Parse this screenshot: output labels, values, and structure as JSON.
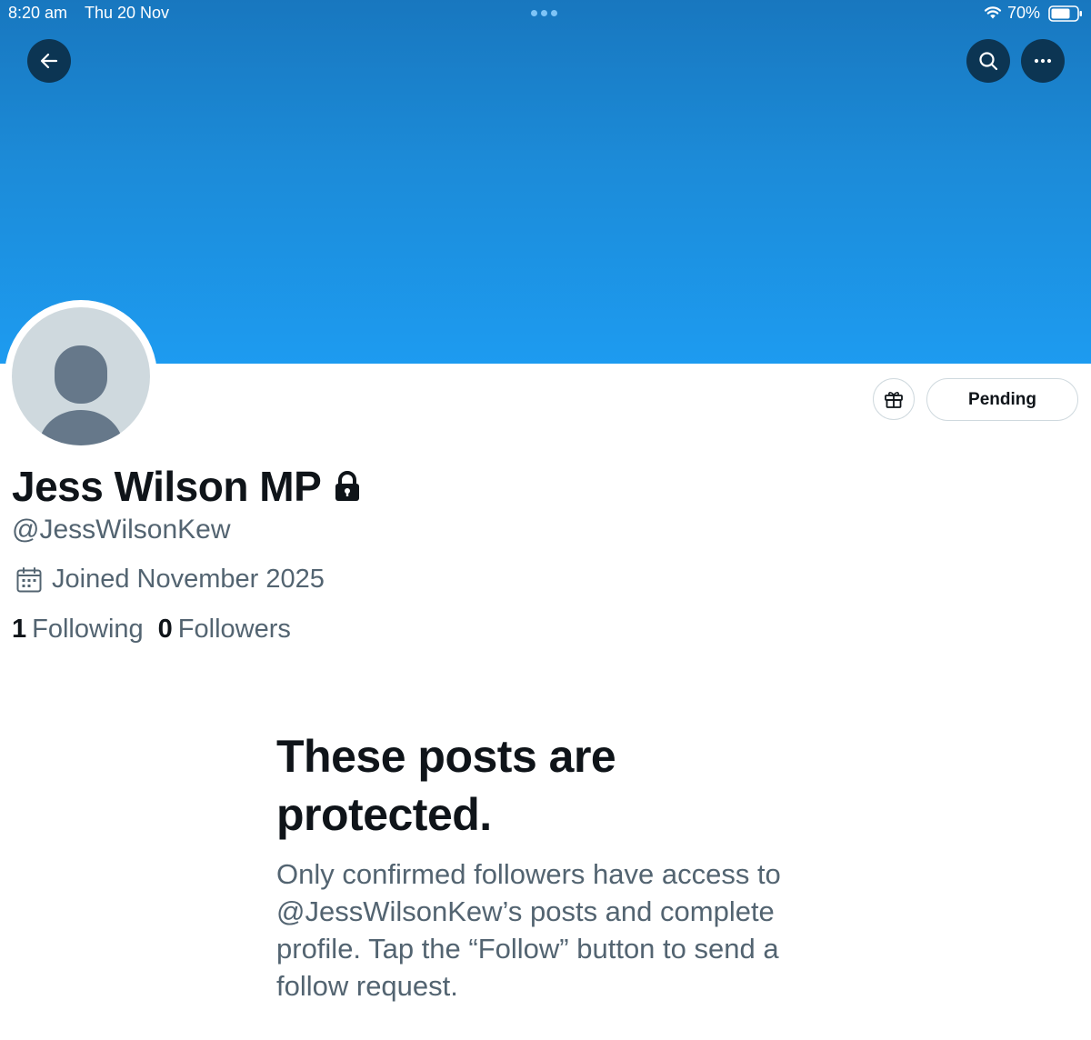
{
  "status_bar": {
    "time": "8:20 am",
    "date": "Thu 20 Nov",
    "battery": "70%"
  },
  "header": {
    "back_icon": "arrow-left-icon",
    "search_icon": "search-icon",
    "more_icon": "more-horizontal-icon",
    "banner_color": "#1d9bf0"
  },
  "profile": {
    "display_name": "Jess Wilson MP",
    "handle": "@JessWilsonKew",
    "protected_icon": "lock-icon",
    "joined": "Joined November 2025",
    "following_count": "1",
    "following_label": "Following",
    "followers_count": "0",
    "followers_label": "Followers"
  },
  "actions": {
    "gift_icon": "gift-icon",
    "pending_label": "Pending"
  },
  "protected_notice": {
    "title": "These posts are protected.",
    "body": "Only confirmed followers have access to @JessWilsonKew’s posts and complete profile. Tap the “Follow” button to send a follow request."
  }
}
